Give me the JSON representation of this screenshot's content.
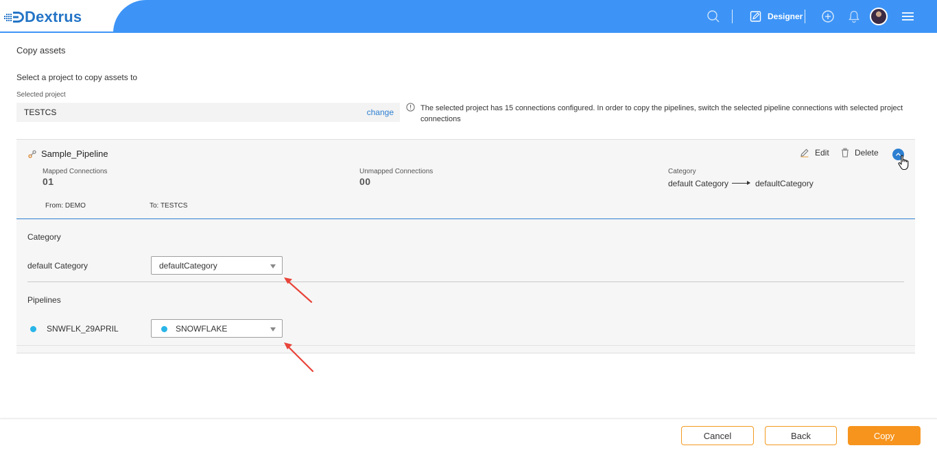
{
  "header": {
    "logo_text": "Dextrus",
    "designer_label": "Designer"
  },
  "page": {
    "title": "Copy assets",
    "select_prompt": "Select a project to copy assets to",
    "selected_project_label": "Selected project",
    "selected_project": "TESTCS",
    "change_label": "change",
    "info_text": "The selected project has 15 connections configured. In order to copy the pipelines, switch the selected pipeline connections with selected project connections"
  },
  "pipeline": {
    "name": "Sample_Pipeline",
    "edit_label": "Edit",
    "delete_label": "Delete",
    "mapped_label": "Mapped Connections",
    "mapped_value": "01",
    "unmapped_label": "Unmapped Connections",
    "unmapped_value": "00",
    "category_label": "Category",
    "category_from": "default Category",
    "category_to": "defaultCategory",
    "from_text": "From: DEMO",
    "to_text": "To: TESTCS"
  },
  "mapping": {
    "category_section": "Category",
    "category_source": "default Category",
    "category_selected": "defaultCategory",
    "pipelines_section": "Pipelines",
    "connection_source": "SNWFLK_29APRIL",
    "connection_selected": "SNOWFLAKE"
  },
  "footer": {
    "cancel_label": "Cancel",
    "back_label": "Back",
    "copy_label": "Copy"
  },
  "colors": {
    "header_blue": "#3d94f6",
    "link_blue": "#2d7fd1",
    "primary_orange": "#f7941d",
    "snowflake_cyan": "#29b5e8",
    "annotation_red": "#e8443a"
  }
}
